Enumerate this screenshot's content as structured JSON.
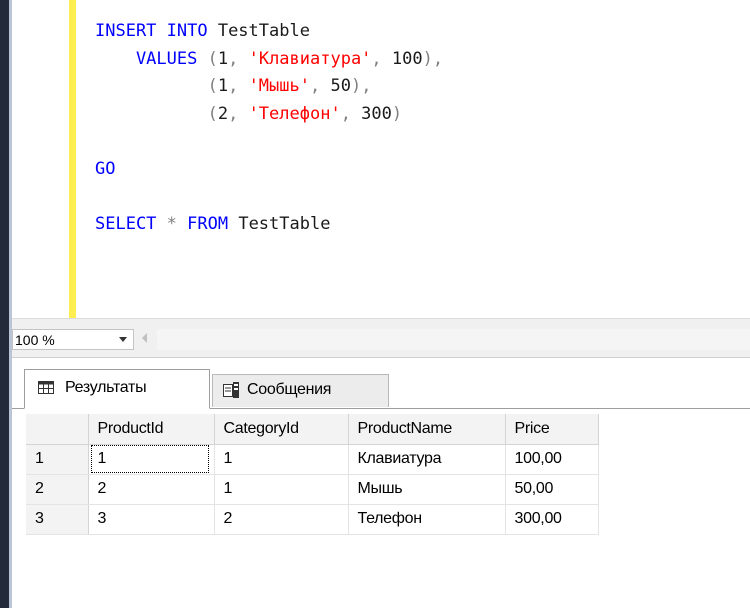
{
  "editor": {
    "lines": [
      {
        "tokens": [
          {
            "t": "INSERT INTO",
            "c": "kw"
          },
          {
            "t": " TestTable",
            "c": ""
          }
        ]
      },
      {
        "tokens": [
          {
            "t": "    VALUES",
            "c": "kw"
          },
          {
            "t": " ",
            "c": ""
          },
          {
            "t": "(",
            "c": "op"
          },
          {
            "t": "1",
            "c": ""
          },
          {
            "t": ", ",
            "c": "op"
          },
          {
            "t": "'Клавиатура'",
            "c": "str"
          },
          {
            "t": ", ",
            "c": "op"
          },
          {
            "t": "100",
            "c": ""
          },
          {
            "t": "),",
            "c": "op"
          }
        ]
      },
      {
        "tokens": [
          {
            "t": "           (",
            "c": "op"
          },
          {
            "t": "1",
            "c": ""
          },
          {
            "t": ", ",
            "c": "op"
          },
          {
            "t": "'Мышь'",
            "c": "str"
          },
          {
            "t": ", ",
            "c": "op"
          },
          {
            "t": "50",
            "c": ""
          },
          {
            "t": "),",
            "c": "op"
          }
        ]
      },
      {
        "tokens": [
          {
            "t": "           (",
            "c": "op"
          },
          {
            "t": "2",
            "c": ""
          },
          {
            "t": ", ",
            "c": "op"
          },
          {
            "t": "'Телефон'",
            "c": "str"
          },
          {
            "t": ", ",
            "c": "op"
          },
          {
            "t": "300",
            "c": ""
          },
          {
            "t": ")",
            "c": "op"
          }
        ]
      },
      {
        "tokens": []
      },
      {
        "tokens": [
          {
            "t": "GO",
            "c": "kw"
          }
        ]
      },
      {
        "tokens": []
      },
      {
        "tokens": [
          {
            "t": "SELECT",
            "c": "kw"
          },
          {
            "t": " * ",
            "c": "op"
          },
          {
            "t": "FROM",
            "c": "kw"
          },
          {
            "t": " TestTable",
            "c": ""
          }
        ]
      }
    ]
  },
  "zoom": {
    "value": "100 %"
  },
  "tabs": [
    {
      "label": "Результаты",
      "icon": "grid-icon",
      "active": true
    },
    {
      "label": "Сообщения",
      "icon": "messages-icon",
      "active": false
    }
  ],
  "grid": {
    "columns": [
      "",
      "ProductId",
      "CategoryId",
      "ProductName",
      "Price"
    ],
    "rows": [
      [
        "1",
        "1",
        "1",
        "Клавиатура",
        "100,00"
      ],
      [
        "2",
        "2",
        "1",
        "Мышь",
        "50,00"
      ],
      [
        "3",
        "3",
        "2",
        "Телефон",
        "300,00"
      ]
    ]
  },
  "colors": {
    "keyword": "#0000ff",
    "string": "#ff0000",
    "operator": "#808080",
    "change_bar": "#ffee4f"
  }
}
